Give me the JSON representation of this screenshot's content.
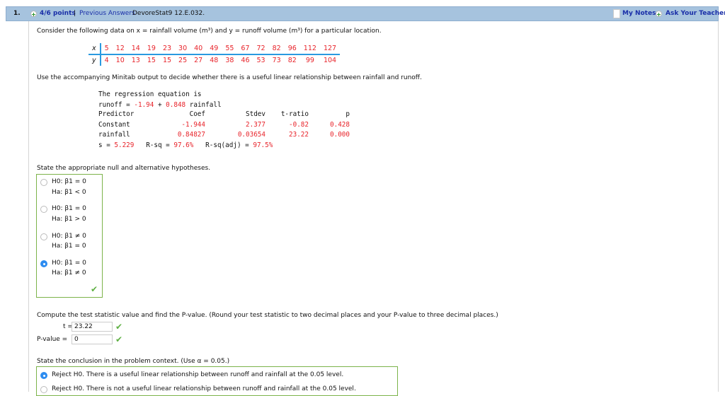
{
  "header": {
    "number": "1.",
    "points": "4/6 points",
    "separator": "|",
    "previous_answers": "Previous Answers",
    "problem_id": "DevoreStat9 12.E.032.",
    "my_notes": "My Notes",
    "ask_teacher": "Ask Your Teacher"
  },
  "intro": "Consider the following data on x = rainfall volume (m³) and y = runoff volume (m³) for a particular location.",
  "data_table": {
    "x_label": "x",
    "y_label": "y",
    "x": [
      "5",
      "12",
      "14",
      "19",
      "23",
      "30",
      "40",
      "49",
      "55",
      "67",
      "72",
      "82",
      "96",
      "112",
      "127"
    ],
    "y": [
      "4",
      "10",
      "13",
      "15",
      "15",
      "25",
      "27",
      "48",
      "38",
      "46",
      "53",
      "73",
      "82",
      "99",
      "104"
    ]
  },
  "use_text": "Use the accompanying Minitab output to decide whether there is a useful linear relationship between rainfall and runoff.",
  "minitab": {
    "line1": "The regression equation is",
    "eq_prefix": "runoff = ",
    "eq_b0": "-1.94",
    "eq_plus": " + ",
    "eq_b1": "0.848",
    "eq_suffix": " rainfall",
    "headers": [
      "Predictor",
      "Coef",
      "Stdev",
      "t-ratio",
      "p"
    ],
    "rows": [
      [
        "Constant",
        "-1.944",
        "2.377",
        "-0.82",
        "0.428"
      ],
      [
        "rainfall",
        "0.84827",
        "0.03654",
        "23.22",
        "0.000"
      ]
    ],
    "s_label": "s = ",
    "s": "5.229",
    "rsq_label": "R-sq = ",
    "rsq": "97.6%",
    "rsqadj_label": "R-sq(adj) = ",
    "rsqadj": "97.5%"
  },
  "hyp_prompt": "State the appropriate null and alternative hypotheses.",
  "hyp_options": [
    {
      "h0": "H0: β1 = 0",
      "ha": "Ha: β1 < 0"
    },
    {
      "h0": "H0: β1 = 0",
      "ha": "Ha: β1 > 0"
    },
    {
      "h0": "H0: β1 ≠ 0",
      "ha": "Ha: β1 = 0"
    },
    {
      "h0": "H0: β1 = 0",
      "ha": "Ha: β1 ≠ 0"
    }
  ],
  "hyp_selected": 3,
  "compute_prompt": "Compute the test statistic value and find the P-value. (Round your test statistic to two decimal places and your P-value to three decimal places.)",
  "t_label": "t =",
  "t_value": "23.22",
  "p_label": "P-value =",
  "p_value": "0",
  "conclusion_prompt": "State the conclusion in the problem context. (Use α = 0.05.)",
  "conclusion_options": [
    "Reject H0. There is a useful linear relationship between runoff and rainfall at the 0.05 level.",
    "Reject H0. There is not a useful linear relationship between runoff and rainfall at the 0.05 level."
  ],
  "colors": {
    "header_bg": "#a6c3de",
    "link": "#1a2fa8",
    "value_red": "#e8232a",
    "correct_green": "#5fb043",
    "radio_selected": "#2d8cf0"
  }
}
